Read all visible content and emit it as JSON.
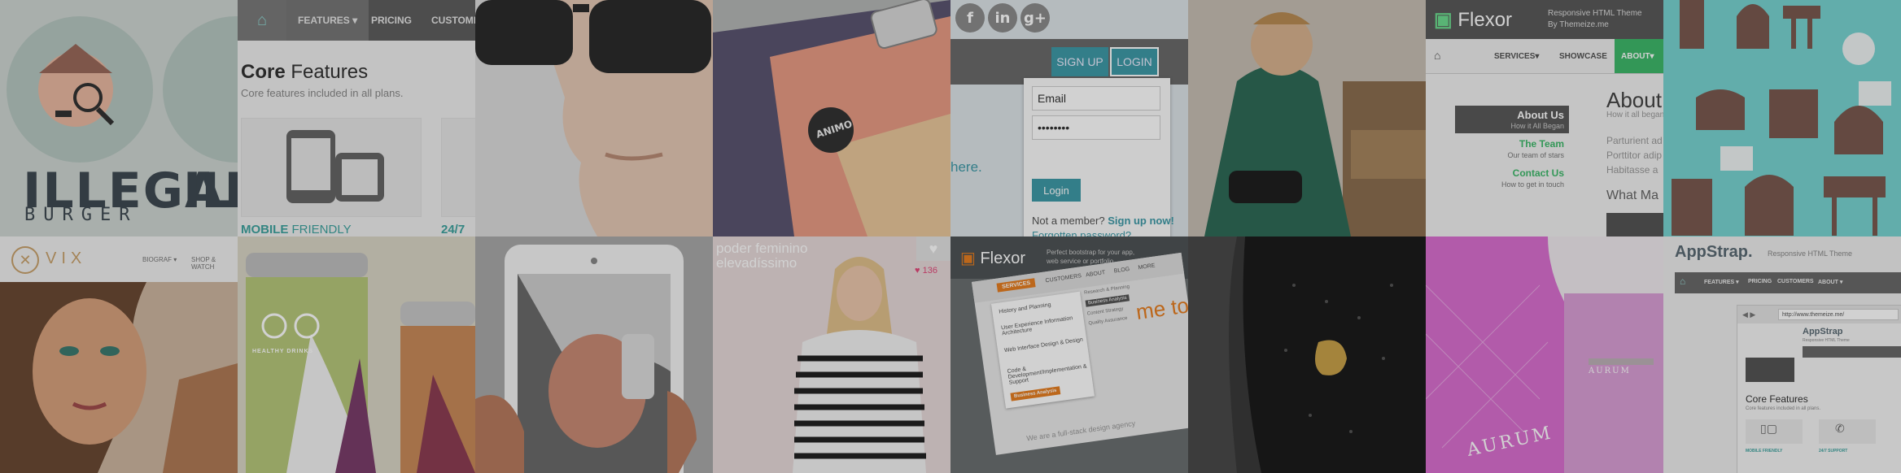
{
  "tiles": {
    "illegal_burger": {
      "word1": "ILLEGAL",
      "word2": "BURGER"
    },
    "core_features": {
      "nav": [
        "FEATURES ▾",
        "PRICING",
        "CUSTOMERS"
      ],
      "title_strong": "Core",
      "title_rest": " Features",
      "subtitle": "Core features included in all plans.",
      "label1": "MOBILE",
      "label1_rest": " FRIENDLY",
      "label2": "24/7"
    },
    "animo": {
      "brand": "ANIMO"
    },
    "login": {
      "signup": "SIGN UP",
      "login": "LOGIN",
      "email": "Email",
      "password": "••••••••",
      "login_button": "Login",
      "not_member": "Not a member?",
      "signup_now": "Sign up now!",
      "forgot": "Forgotten password?",
      "link_here": "here."
    },
    "flexor": {
      "brand": "Flexor",
      "tagline1": "Responsive HTML Theme",
      "tagline2": "By Themeize.me",
      "nav": [
        "SERVICES▾",
        "SHOWCASE",
        "ABOUT▾"
      ],
      "menu_title": "About Us",
      "menu_sub": "How it All Began",
      "item1": "The Team",
      "item1_sub": "Our team of stars",
      "item2": "Contact Us",
      "item2_sub": "How to get in touch",
      "side_title": "About",
      "side_sub": "How it all began",
      "side_text1": "Parturient ad",
      "side_text2": "Porttitor adip",
      "side_text3": "Habitasse a",
      "side_heading": "What Ma"
    },
    "vix": {
      "brand": "VIX",
      "nav": [
        "BIOGRAF ▾",
        "SHOP & WATCH"
      ]
    },
    "bottles": {
      "label": "HEALTHY DRINKS"
    },
    "tablet": {},
    "fashion": {
      "line1": "poder feminino",
      "line2": "elevadíssimo",
      "likes": "136"
    },
    "flexor_device": {
      "brand": "Flexor",
      "tag1": "Perfect bootstrap for your app,",
      "tag2": "web service or portfolio",
      "menu": [
        "SERVICES",
        "CUSTOMERS",
        "ABOUT",
        "BLOG",
        "MORE"
      ],
      "items": [
        "History and Planning",
        "User Experience Information Architecture",
        "Web Interface Design & Design",
        "Code & Development/Implementation & Support",
        "Business Analysis"
      ],
      "side_items": [
        "Research & Planning",
        "Business Analysis",
        "Content Strategy",
        "Quality Assurance"
      ],
      "welcome": "me to F",
      "footer": "We are a full-stack design agency"
    },
    "aurum": {
      "brand": "AURUM"
    },
    "appstrap": {
      "brand": "AppStrap.",
      "tagline": "Responsive HTML Theme",
      "nav": [
        "FEATURES ▾",
        "PRICING",
        "CUSTOMERS",
        "ABOUT ▾"
      ],
      "url": "http://www.themeize.me/",
      "inner_brand": "AppStrap",
      "inner_tagline": "Responsive HTML Theme",
      "title": "Core Features",
      "subtitle": "Core features included in all plans.",
      "f1": "MOBILE FRIENDLY",
      "f2": "24/7 SUPPORT"
    }
  },
  "colors": {
    "teal": "#3f9aa8",
    "green": "#3fb96b",
    "overlay": "rgba(0,0,0,0.18)"
  }
}
